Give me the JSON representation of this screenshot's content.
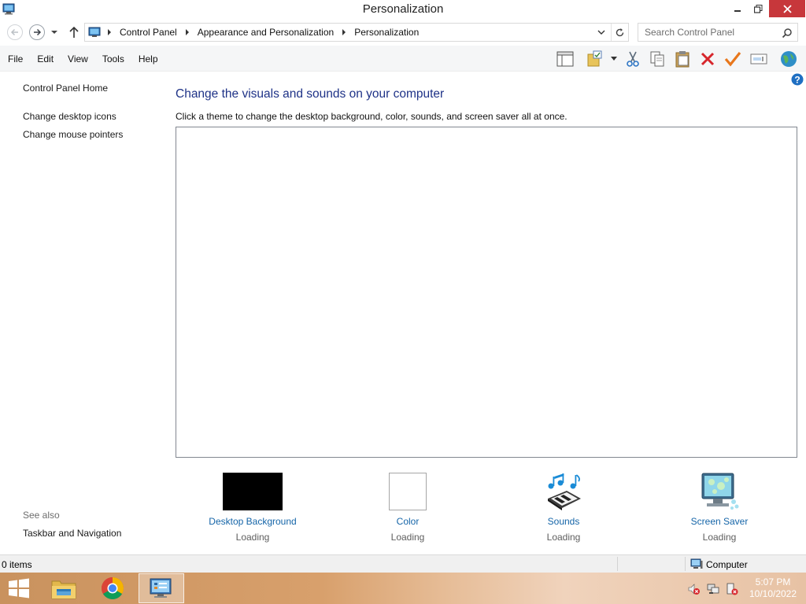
{
  "window": {
    "title": "Personalization"
  },
  "address_bar": {
    "crumbs": [
      "Control Panel",
      "Appearance and Personalization",
      "Personalization"
    ]
  },
  "search": {
    "placeholder": "Search Control Panel"
  },
  "menu": {
    "items": [
      "File",
      "Edit",
      "View",
      "Tools",
      "Help"
    ]
  },
  "toolbar": {
    "icons": [
      "layout-icon",
      "folder-properties-icon",
      "cut-icon",
      "copy-icon",
      "paste-icon",
      "delete-icon",
      "check-icon",
      "rename-icon",
      "globe-icon"
    ]
  },
  "left_pane": {
    "home": "Control Panel Home",
    "links": [
      "Change desktop icons",
      "Change mouse pointers"
    ],
    "see_also_label": "See also",
    "see_also_links": [
      "Taskbar and Navigation"
    ]
  },
  "main": {
    "heading": "Change the visuals and sounds on your computer",
    "subtitle": "Click a theme to change the desktop background, color, sounds, and screen saver all at once.",
    "tiles": [
      {
        "label": "Desktop Background",
        "status": "Loading",
        "swatch": "#000000"
      },
      {
        "label": "Color",
        "status": "Loading",
        "swatch": "#ffffff"
      },
      {
        "label": "Sounds",
        "status": "Loading"
      },
      {
        "label": "Screen Saver",
        "status": "Loading"
      }
    ]
  },
  "status_bar": {
    "items_count": "0 items",
    "location": "Computer"
  },
  "taskbar": {
    "apps": [
      "file-explorer-icon",
      "chrome-icon",
      "control-panel-icon"
    ],
    "active_app": "control-panel-icon",
    "clock_time": "5:07 PM",
    "clock_date": "10/10/2022"
  },
  "colors": {
    "heading": "#1e3287",
    "link": "#1565a8",
    "close_button": "#c7373b"
  }
}
